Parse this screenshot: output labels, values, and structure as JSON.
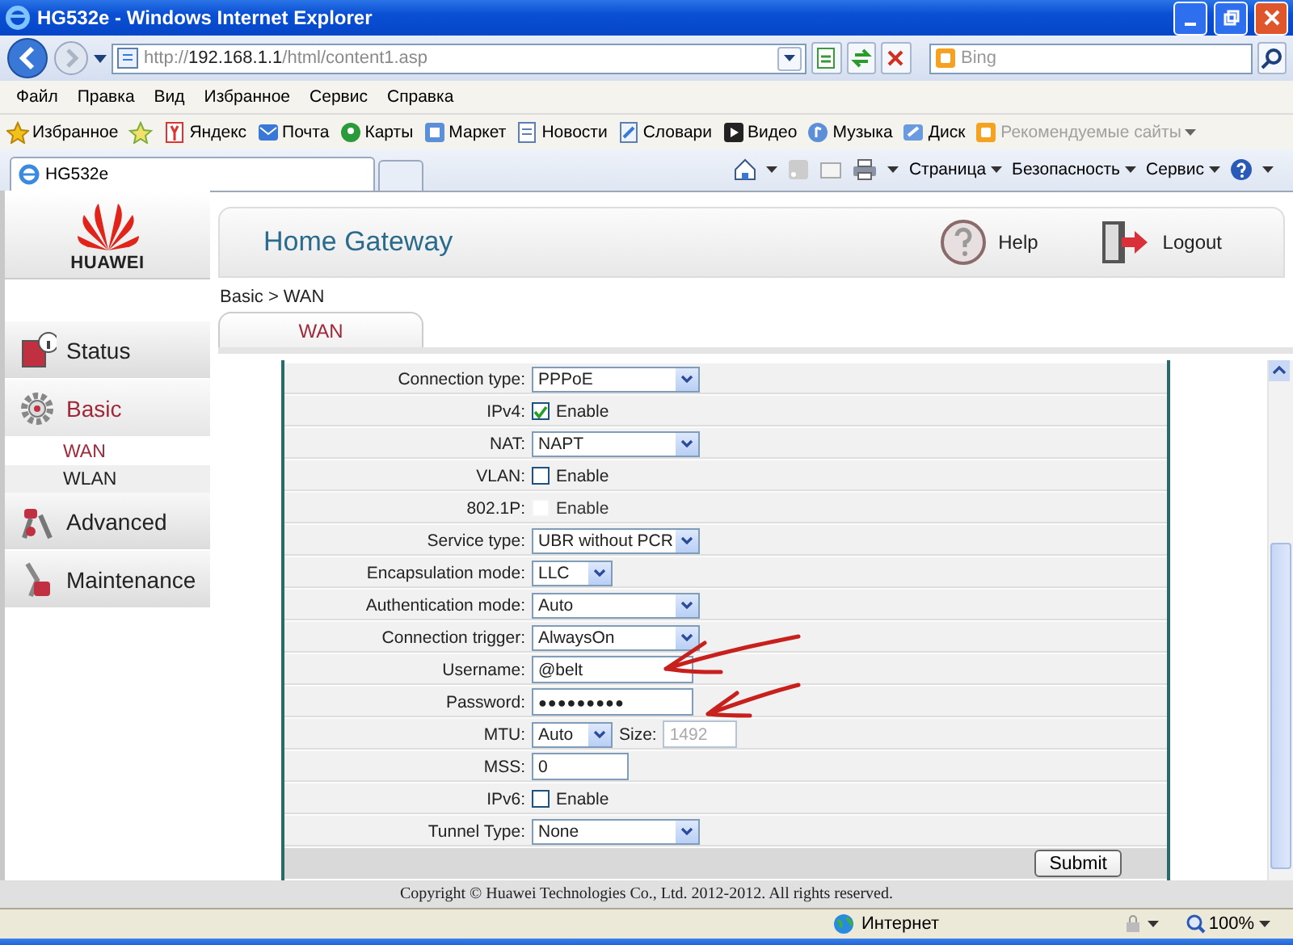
{
  "window": {
    "title": "HG532e - Windows Internet Explorer"
  },
  "address_bar": {
    "scheme": "http://",
    "host": "192.168.1.1",
    "path": "/html/content1.asp",
    "search_placeholder": "Bing"
  },
  "menu": [
    "Файл",
    "Правка",
    "Вид",
    "Избранное",
    "Сервис",
    "Справка"
  ],
  "favorites": {
    "label": "Избранное",
    "items": [
      {
        "label": "Яндекс",
        "disabled": false
      },
      {
        "label": "Почта",
        "disabled": false
      },
      {
        "label": "Карты",
        "disabled": false
      },
      {
        "label": "Маркет",
        "disabled": false
      },
      {
        "label": "Новости",
        "disabled": false
      },
      {
        "label": "Словари",
        "disabled": false
      },
      {
        "label": "Видео",
        "disabled": false
      },
      {
        "label": "Музыка",
        "disabled": false
      },
      {
        "label": "Диск",
        "disabled": false
      },
      {
        "label": "Рекомендуемые сайты",
        "disabled": true
      }
    ]
  },
  "tabs": [
    {
      "label": "HG532e",
      "selected": true
    }
  ],
  "command_bar": [
    "Страница",
    "Безопасность",
    "Сервис"
  ],
  "router": {
    "logo": "HUAWEI",
    "title": "Home Gateway",
    "help": "Help",
    "logout": "Logout",
    "breadcrumb": "Basic > WAN",
    "sidebar": {
      "items": [
        {
          "label": "Status",
          "selected": false
        },
        {
          "label": "Basic",
          "selected": true,
          "children": [
            {
              "label": "WAN",
              "selected": true
            },
            {
              "label": "WLAN",
              "selected": false
            }
          ]
        },
        {
          "label": "Advanced",
          "selected": false
        },
        {
          "label": "Maintenance",
          "selected": false
        }
      ]
    },
    "tabs": [
      {
        "label": "WAN",
        "selected": true
      }
    ],
    "form": {
      "rows": [
        {
          "label": "Connection type:",
          "kind": "select",
          "value": "PPPoE"
        },
        {
          "label": "IPv4:",
          "kind": "checkbox",
          "text": "Enable",
          "checked": true,
          "disabled": false
        },
        {
          "label": "NAT:",
          "kind": "select",
          "value": "NAPT"
        },
        {
          "label": "VLAN:",
          "kind": "checkbox",
          "text": "Enable",
          "checked": false,
          "disabled": false
        },
        {
          "label": "802.1P:",
          "kind": "checkbox",
          "text": "Enable",
          "checked": false,
          "disabled": true
        },
        {
          "label": "Service type:",
          "kind": "select",
          "value": "UBR without PCR"
        },
        {
          "label": "Encapsulation mode:",
          "kind": "short-select",
          "value": "LLC"
        },
        {
          "label": "Authentication mode:",
          "kind": "select",
          "value": "Auto"
        },
        {
          "label": "Connection trigger:",
          "kind": "select",
          "value": "AlwaysOn"
        },
        {
          "label": "Username:",
          "kind": "text",
          "value": "@belt"
        },
        {
          "label": "Password:",
          "kind": "password",
          "value": "●●●●●●●●●"
        },
        {
          "label": "MTU:",
          "kind": "mtu",
          "value": "Auto",
          "size_label": "Size:",
          "size_value": "1492",
          "size_disabled": true
        },
        {
          "label": "MSS:",
          "kind": "short-text",
          "value": "0"
        },
        {
          "label": "IPv6:",
          "kind": "checkbox",
          "text": "Enable",
          "checked": false,
          "disabled": false
        },
        {
          "label": "Tunnel Type:",
          "kind": "select",
          "value": "None"
        }
      ],
      "submit": "Submit"
    },
    "footer": "Copyright © Huawei Technologies Co., Ltd. 2012-2012. All rights reserved."
  },
  "status_bar": {
    "zone": "Интернет",
    "zoom": "100%"
  }
}
